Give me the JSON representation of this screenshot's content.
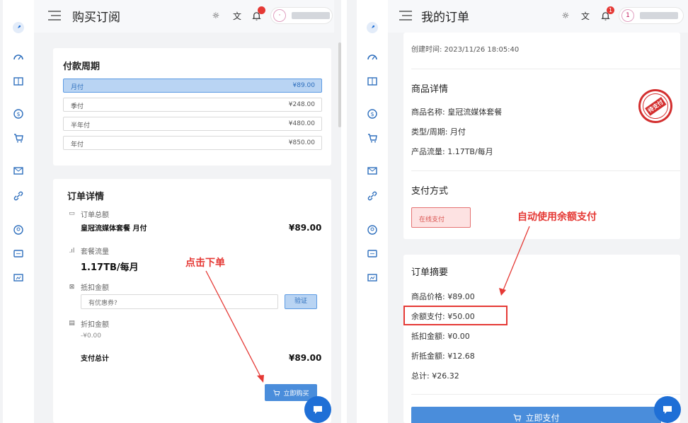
{
  "left": {
    "title": "购买订阅",
    "period": {
      "title": "付款周期",
      "options": [
        {
          "label": "月付",
          "price": "¥89.00"
        },
        {
          "label": "季付",
          "price": "¥248.00"
        },
        {
          "label": "半年付",
          "price": "¥480.00"
        },
        {
          "label": "年付",
          "price": "¥850.00"
        }
      ]
    },
    "order": {
      "title": "订单详情",
      "total_label": "订单总额",
      "product": "皇冠流媒体套餐 月付",
      "product_price": "¥89.00",
      "traffic_label": "套餐流量",
      "traffic": "1.17TB/每月",
      "discount_label": "抵扣金额",
      "coupon_placeholder": "有优惠券?",
      "verify": "验证",
      "reduce_label": "折扣金额",
      "reduce_value": "-¥0.00",
      "pay_total_label": "支付总计",
      "pay_total": "¥89.00",
      "buy": "立即购买"
    },
    "annotation": "点击下单"
  },
  "right": {
    "title": "我的订单",
    "created": "创建时间: 2023/11/26 18:05:40",
    "goods": {
      "title": "商品详情",
      "name": "商品名称: 皇冠流媒体套餐",
      "period": "类型/周期: 月付",
      "traffic": "产品流量:  1.17TB/每月",
      "stamp": "待支付"
    },
    "payment": {
      "title": "支付方式",
      "method": "在线支付"
    },
    "annotation": "自动使用余额支付",
    "summary": {
      "title": "订单摘要",
      "price": "商品价格: ¥89.00",
      "balance": "余额支付: ¥50.00",
      "discount": "抵扣金额: ¥0.00",
      "refund": "折抵金额: ¥12.68",
      "total": "总计: ¥26.32",
      "pay": "立即支付"
    }
  },
  "user": {
    "badge_left": "",
    "badge_right": "1",
    "avatar_text": "1"
  },
  "colors": {
    "accent": "#4a8ddb",
    "annotation": "#e53935",
    "active_fill": "#b9d4f3"
  }
}
